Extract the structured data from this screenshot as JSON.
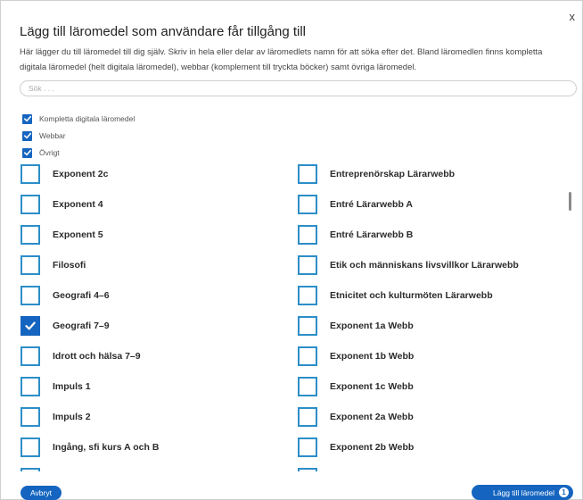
{
  "dialog": {
    "title": "Lägg till läromedel som användare får tillgång till",
    "close": "x",
    "description": "Här lägger du till läromedel till dig själv. Skriv in hela eller delar av läromedlets namn för att söka efter det. Bland läromedlen finns kompletta digitala läromedel (helt digitala läromedel), webbar (komplement till tryckta böcker) samt övriga läromedel."
  },
  "search": {
    "placeholder": "Sök . . ."
  },
  "filters": [
    {
      "label": "Kompletta digitala läromedel",
      "checked": true
    },
    {
      "label": "Webbar",
      "checked": true
    },
    {
      "label": "Övrigt",
      "checked": true
    }
  ],
  "left_column": [
    {
      "label": "Exponent 2c",
      "checked": false
    },
    {
      "label": "Exponent 4",
      "checked": false
    },
    {
      "label": "Exponent 5",
      "checked": false
    },
    {
      "label": "Filosofi",
      "checked": false
    },
    {
      "label": "Geografi 4–6",
      "checked": false
    },
    {
      "label": "Geografi 7–9",
      "checked": true
    },
    {
      "label": "Idrott och hälsa 7–9",
      "checked": false
    },
    {
      "label": "Impuls 1",
      "checked": false
    },
    {
      "label": "Impuls 2",
      "checked": false
    },
    {
      "label": "Ingång, sfi kurs A och B",
      "checked": false
    },
    {
      "label": "",
      "checked": false
    }
  ],
  "right_column": [
    {
      "label": "Entreprenörskap Lärarwebb",
      "checked": false
    },
    {
      "label": "Entré Lärarwebb A",
      "checked": false
    },
    {
      "label": "Entré Lärarwebb B",
      "checked": false
    },
    {
      "label": "Etik och människans livsvillkor Lärarwebb",
      "checked": false
    },
    {
      "label": "Etnicitet och kulturmöten Lärarwebb",
      "checked": false
    },
    {
      "label": "Exponent 1a Webb",
      "checked": false
    },
    {
      "label": "Exponent 1b Webb",
      "checked": false
    },
    {
      "label": "Exponent 1c Webb",
      "checked": false
    },
    {
      "label": "Exponent 2a Webb",
      "checked": false
    },
    {
      "label": "Exponent 2b Webb",
      "checked": false
    },
    {
      "label": "",
      "checked": false
    }
  ],
  "buttons": {
    "cancel": "Avbryt",
    "add": "Lägg till läromedel",
    "add_count": "1"
  },
  "colors": {
    "accent": "#1565c0",
    "checkbox_border": "#2c8ec8"
  }
}
